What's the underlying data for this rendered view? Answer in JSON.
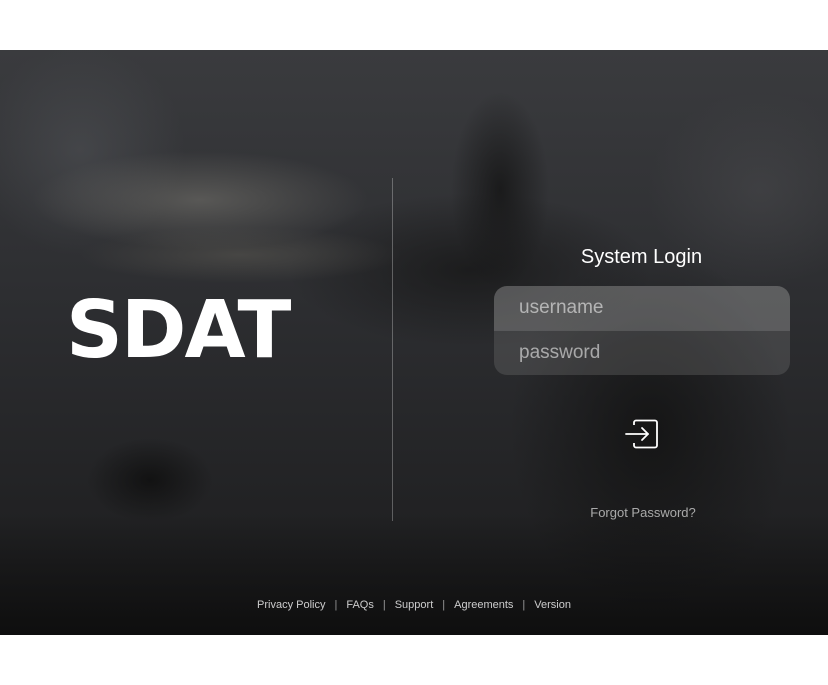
{
  "brand": {
    "name": "SDAT"
  },
  "login": {
    "title": "System Login",
    "username_placeholder": "username",
    "password_placeholder": "password",
    "submit_icon": "login-arrow-icon",
    "forgot_password": "Forgot Password?"
  },
  "footer": {
    "links": [
      "Privacy Policy",
      "FAQs",
      "Support",
      "Agreements",
      "Version"
    ],
    "separator": "|"
  },
  "colors": {
    "text": "#ffffff",
    "background": "#2b2c2e"
  }
}
